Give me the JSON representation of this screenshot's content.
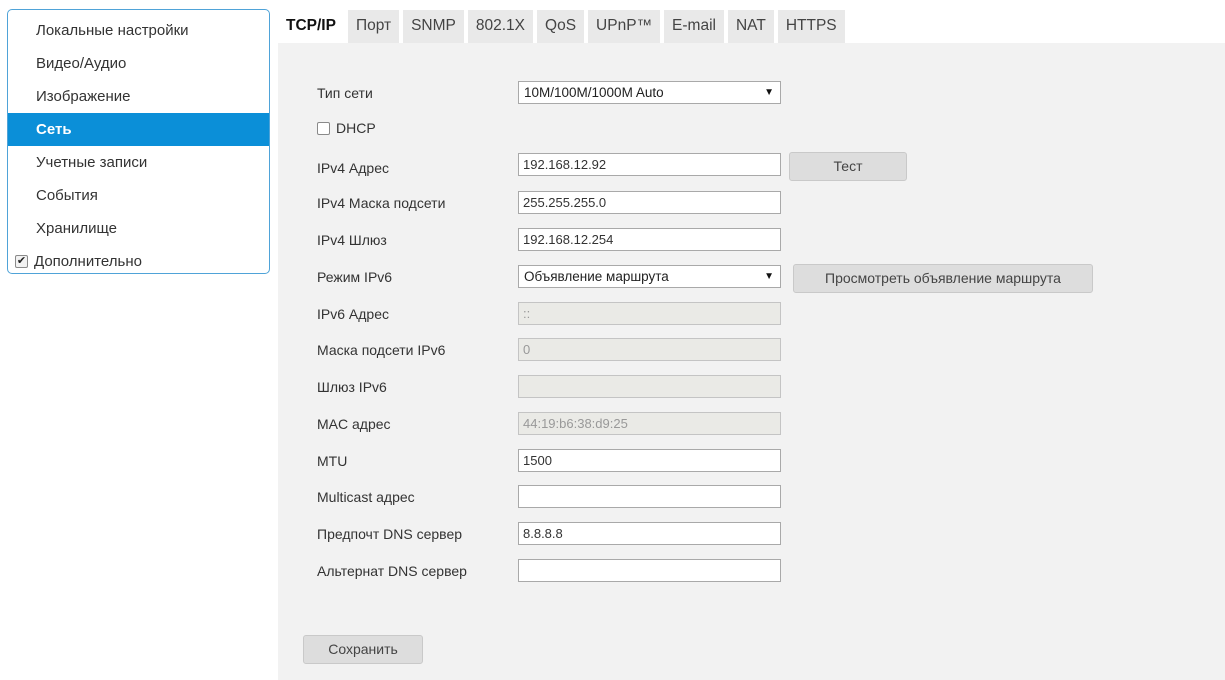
{
  "sidebar": {
    "items": [
      {
        "label": "Локальные настройки"
      },
      {
        "label": "Видео/Аудио"
      },
      {
        "label": "Изображение"
      },
      {
        "label": "Сеть"
      },
      {
        "label": "Учетные записи"
      },
      {
        "label": "События"
      },
      {
        "label": "Хранилище"
      }
    ],
    "active_index": 3,
    "advanced": {
      "label": "Дополнительно",
      "checked": true
    }
  },
  "tabs": [
    {
      "label": "TCP/IP"
    },
    {
      "label": "Порт"
    },
    {
      "label": "SNMP"
    },
    {
      "label": "802.1X"
    },
    {
      "label": "QoS"
    },
    {
      "label": "UPnP™"
    },
    {
      "label": "E-mail"
    },
    {
      "label": "NAT"
    },
    {
      "label": "HTTPS"
    }
  ],
  "active_tab_index": 0,
  "form": {
    "network_type": {
      "label": "Тип сети",
      "value": "10M/100M/1000M Auto"
    },
    "dhcp": {
      "label": "DHCP",
      "checked": false
    },
    "ipv4_address": {
      "label": "IPv4 Адрес",
      "value": "192.168.12.92"
    },
    "test_button": "Тест",
    "ipv4_mask": {
      "label": "IPv4 Маска подсети",
      "value": "255.255.255.0"
    },
    "ipv4_gateway": {
      "label": "IPv4 Шлюз",
      "value": "192.168.12.254"
    },
    "ipv6_mode": {
      "label": "Режим IPv6",
      "value": "Объявление маршрута"
    },
    "view_route_button": "Просмотреть объявление маршрута",
    "ipv6_address": {
      "label": "IPv6 Адрес",
      "value": "::"
    },
    "ipv6_mask": {
      "label": "Маска подсети IPv6",
      "value": "0"
    },
    "ipv6_gateway": {
      "label": "Шлюз IPv6",
      "value": ""
    },
    "mac_address": {
      "label": "MAC адрес",
      "value": "44:19:b6:38:d9:25"
    },
    "mtu": {
      "label": "MTU",
      "value": "1500"
    },
    "multicast": {
      "label": "Multicast адрес",
      "value": ""
    },
    "preferred_dns": {
      "label": "Предпочт DNS сервер",
      "value": "8.8.8.8"
    },
    "alternate_dns": {
      "label": "Альтернат DNS сервер",
      "value": ""
    },
    "save_button": "Сохранить"
  },
  "colors": {
    "accent": "#0b8fd8",
    "sidebar_border": "#4fa3d8",
    "panel_bg": "#f2f2f2",
    "tab_bg": "#e9e9e9"
  }
}
